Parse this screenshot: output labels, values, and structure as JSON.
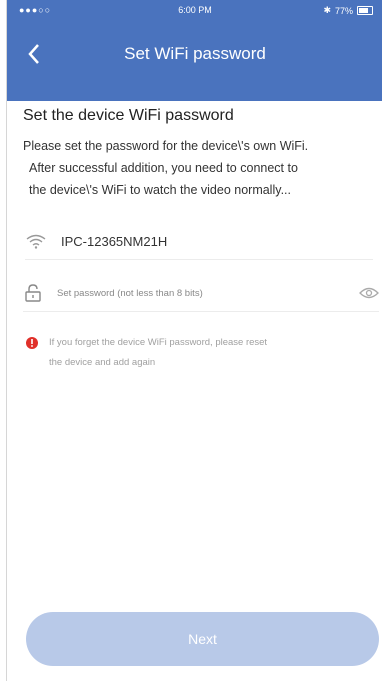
{
  "status_bar": {
    "carrier": "●●●○○",
    "time": "6:00 PM",
    "battery": "77%"
  },
  "nav": {
    "title": "Set WiFi password"
  },
  "main": {
    "heading": "Set the device WiFi password",
    "desc_lines": [
      "Please set the password for the device\\'s own WiFi.",
      "After successful addition, you need to connect to",
      "the device\\'s WiFi to watch the video normally..."
    ],
    "ssid": "IPC-12365NM21H",
    "password_placeholder": "Set password (not less than 8 bits)",
    "warning_lines": [
      "If you forget the device WiFi password, please reset",
      "the device and add again"
    ]
  },
  "footer": {
    "next_label": "Next"
  },
  "colors": {
    "header": "#4a73be",
    "button": "#b8c9e8",
    "warning": "#e0302a"
  },
  "icons": [
    "back-arrow-icon",
    "wifi-icon",
    "lock-icon",
    "eye-icon",
    "warning-icon",
    "bluetooth-icon",
    "battery-icon"
  ]
}
